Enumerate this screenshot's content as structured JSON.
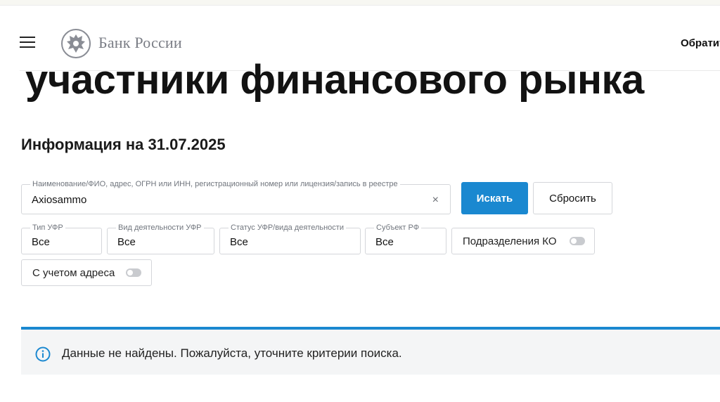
{
  "header": {
    "logo_text": "Банк России",
    "link": "Обратит",
    "logo_icon": "eagle-emblem-icon",
    "menu_icon": "hamburger-menu-icon"
  },
  "page": {
    "title": "участники финансового рынка",
    "info_date": "Информация на 31.07.2025"
  },
  "search": {
    "label": "Наименование/ФИО, адрес, ОГРН или ИНН, регистрационный номер или лицензия/запись в реестре",
    "value": "Axiosammo",
    "clear_glyph": "×",
    "search_button": "Искать",
    "reset_button": "Сбросить"
  },
  "filters": [
    {
      "label": "Тип УФР",
      "value": "Все"
    },
    {
      "label": "Вид деятельности УФР",
      "value": "Все"
    },
    {
      "label": "Статус УФР/вида деятельности",
      "value": "Все"
    },
    {
      "label": "Субъект РФ",
      "value": "Все"
    }
  ],
  "toggles": {
    "ko_units": {
      "label": "Подразделения КО",
      "on": false
    },
    "with_address": {
      "label": "С учетом адреса",
      "on": false
    }
  },
  "alert": {
    "text": "Данные не найдены. Пожалуйста, уточните критерии поиска.",
    "icon": "info-icon",
    "accent": "#1a88d0"
  },
  "colors": {
    "primary": "#1a88d0",
    "logo_gray": "#7a7d85"
  }
}
